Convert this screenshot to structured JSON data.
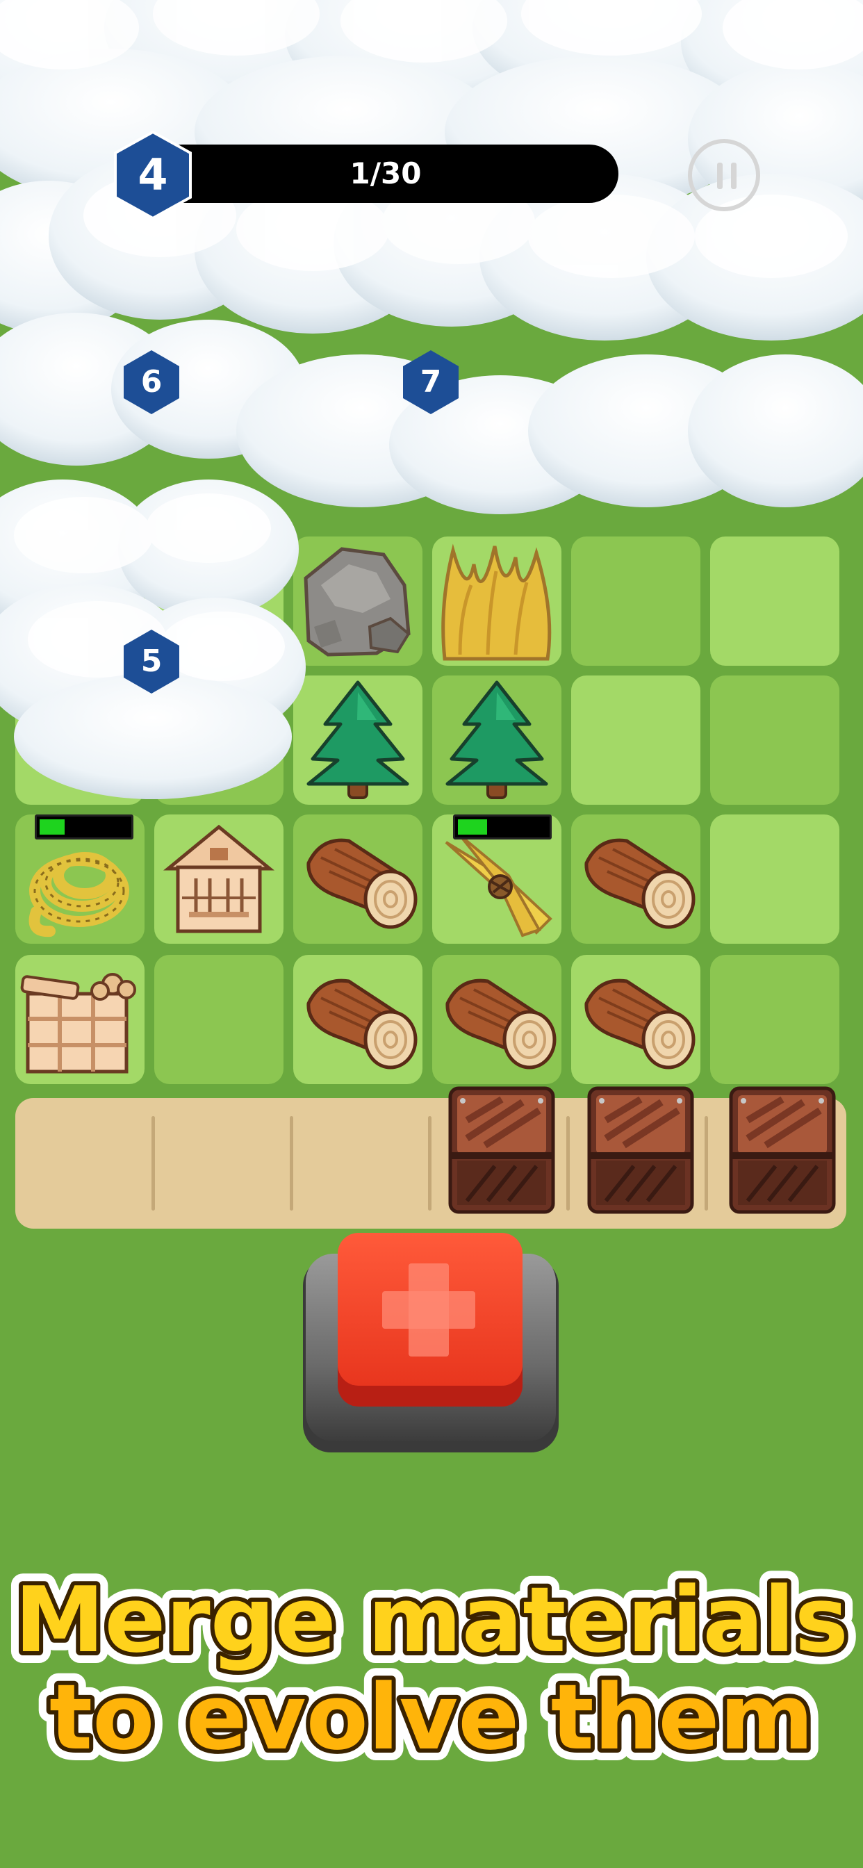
{
  "hud": {
    "level": "4",
    "progress_text": "1/30",
    "progress_fraction": 0.0333
  },
  "locked_zones": [
    {
      "num": "6"
    },
    {
      "num": "7"
    },
    {
      "num": "5"
    }
  ],
  "board": {
    "rows": [
      [
        "hidden",
        "hidden",
        "stone",
        "wheat",
        "empty",
        "empty"
      ],
      [
        "hidden",
        "hidden",
        "tree",
        "tree",
        "empty",
        "empty"
      ],
      [
        "rope",
        "wood-house",
        "log",
        "wheat-bundle",
        "log",
        "empty"
      ],
      [
        "lumber-crate",
        "empty",
        "log",
        "log",
        "log",
        "empty"
      ]
    ],
    "production_bars": [
      {
        "item": "rope",
        "fill_fraction": 0.28
      },
      {
        "item": "wheat-bundle",
        "fill_fraction": 0.33
      }
    ]
  },
  "tray": {
    "slots": 6,
    "items": [
      "empty",
      "empty",
      "empty",
      "chest",
      "chest",
      "chest"
    ]
  },
  "add_button": {
    "icon": "plus-icon"
  },
  "promo": {
    "line1": "Merge materials",
    "line2": "to evolve them"
  },
  "colors": {
    "background": "#6aa93e",
    "tile_dark": "#8cc651",
    "tile_light": "#a3d967",
    "hex_badge": "#1d4e96",
    "add_button": "#f0432a",
    "promo_text": "#ffd21c"
  }
}
